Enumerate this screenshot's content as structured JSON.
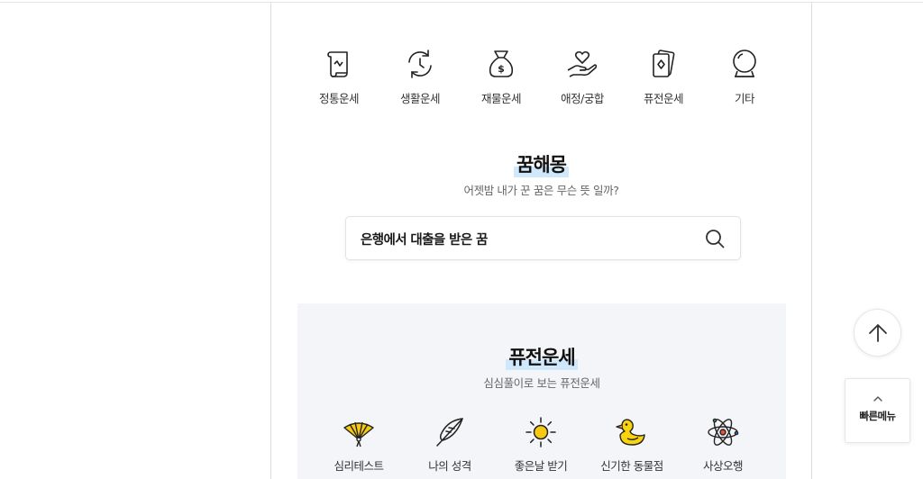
{
  "categories": [
    {
      "label": "정통운세",
      "icon": "scroll-icon"
    },
    {
      "label": "생활운세",
      "icon": "cycle-arrows-icon"
    },
    {
      "label": "재물운세",
      "icon": "money-bag-icon"
    },
    {
      "label": "애정/궁합",
      "icon": "heart-hand-icon"
    },
    {
      "label": "퓨전운세",
      "icon": "cards-icon"
    },
    {
      "label": "기타",
      "icon": "crystal-ball-icon"
    }
  ],
  "dream": {
    "title": "꿈해몽",
    "subtitle": "어젯밤 내가 꾼 꿈은 무슨 뜻 일까?",
    "search_value": "은행에서 대출을 받은 꿈"
  },
  "fusion": {
    "title": "퓨전운세",
    "subtitle": "심심풀이로 보는 퓨전운세",
    "items": [
      {
        "label": "심리테스트",
        "icon": "fan-icon"
      },
      {
        "label": "나의 성격",
        "icon": "feather-icon"
      },
      {
        "label": "좋은날 받기",
        "icon": "sun-icon"
      },
      {
        "label": "신기한 동물점",
        "icon": "duck-icon"
      },
      {
        "label": "사상오행",
        "icon": "atom-icon"
      }
    ]
  },
  "floating": {
    "quick_menu_label": "빠른메뉴"
  },
  "colors": {
    "title_highlight": "#cfe8fb",
    "fusion_bg": "#f3f5f8",
    "fan_yellow": "#f7c913",
    "duck_yellow": "#f9d40d"
  }
}
